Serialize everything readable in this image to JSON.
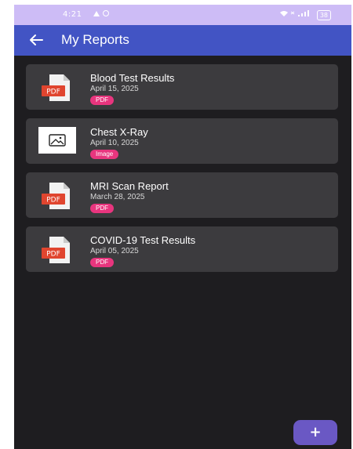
{
  "status_bar": {
    "time": "4:21",
    "battery": "38"
  },
  "app_bar": {
    "title": "My Reports",
    "back_icon": "arrow-left-icon"
  },
  "reports": [
    {
      "name": "Blood Test Results",
      "date": "April 15, 2025",
      "type": "PDF",
      "icon": "pdf-file-icon"
    },
    {
      "name": "Chest X-Ray",
      "date": "April 10, 2025",
      "type": "Image",
      "icon": "image-icon"
    },
    {
      "name": "MRI Scan Report",
      "date": "March 28, 2025",
      "type": "PDF",
      "icon": "pdf-file-icon"
    },
    {
      "name": "COVID-19 Test Results",
      "date": "April 05, 2025",
      "type": "PDF",
      "icon": "pdf-file-icon"
    }
  ],
  "fab": {
    "label": "+",
    "icon": "plus-icon"
  },
  "colors": {
    "status_bar": "#cdbcf6",
    "app_bar": "#4254c4",
    "background": "#1e1d20",
    "card": "#3c3b3e",
    "badge": "#e8357e",
    "fab": "#6a58c4",
    "pdf_red": "#e0452f"
  }
}
